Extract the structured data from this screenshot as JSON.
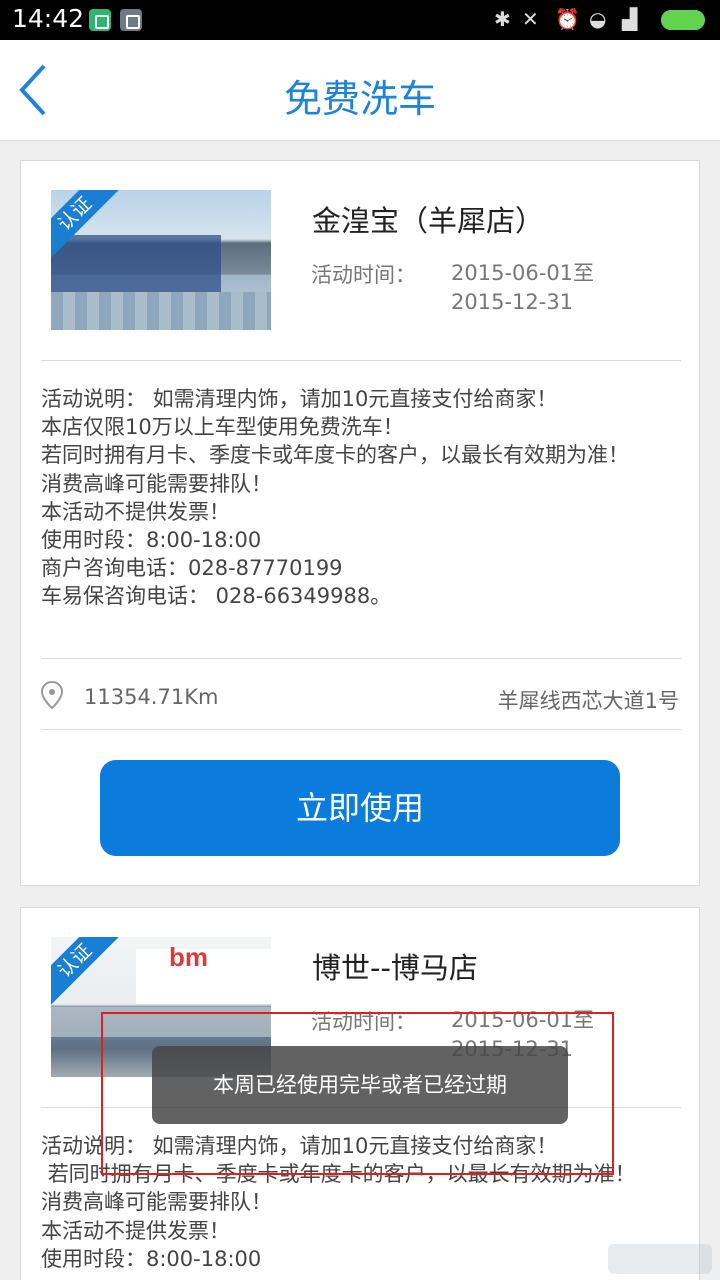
{
  "status_bar": {
    "time": "14:42"
  },
  "header": {
    "title": "免费洗车"
  },
  "stores": [
    {
      "badge": "认证",
      "name": "金湟宝（羊犀店）",
      "time_label": "活动时间：",
      "time_start": "2015-06-01至",
      "time_end": "2015-12-31",
      "description": "活动说明： 如需清理内饰，请加10元直接支付给商家！\n本店仅限10万以上车型使用免费洗车！\n若同时拥有月卡、季度卡或年度卡的客户，以最长有效期为准！\n消费高峰可能需要排队！\n本活动不提供发票！\n使用时段：8:00-18:00\n商户咨询电话：028-87770199\n车易保咨询电话： 028-66349988。",
      "distance": "11354.71Km",
      "address": "羊犀线西芯大道1号",
      "button": "立即使用"
    },
    {
      "badge": "认证",
      "name": "博世--博马店",
      "time_label": "活动时间：",
      "time_start": "2015-06-01至",
      "time_end": "2015-12-31",
      "description": "活动说明： 如需清理内饰，请加10元直接支付给商家！\n 若同时拥有月卡、季度卡或年度卡的客户，以最长有效期为准！\n消费高峰可能需要排队！\n本活动不提供发票！\n使用时段：8:00-18:00"
    }
  ],
  "toast": {
    "message": "本周已经使用完毕或者已经过期"
  },
  "colors": {
    "accent": "#1f84d6",
    "button": "#0b7bdc",
    "highlight": "#e02020"
  }
}
